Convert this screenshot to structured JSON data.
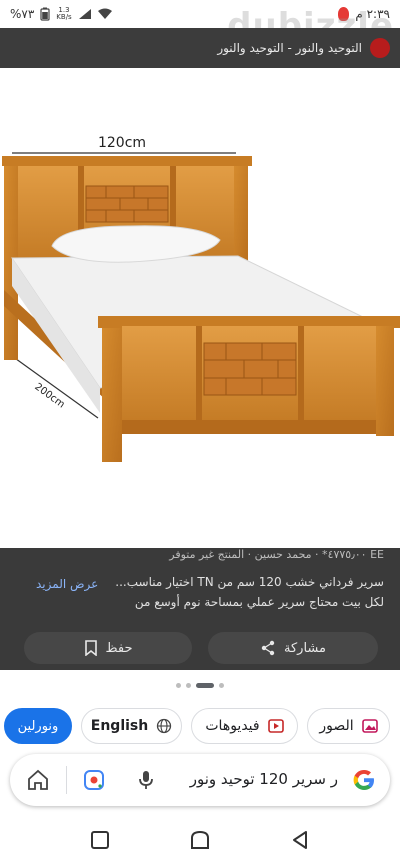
{
  "status_bar": {
    "time": "٢:٣٩ م",
    "battery": "%٧٣",
    "speed_value": "1.3",
    "speed_unit": "KB/s"
  },
  "watermark": "dubizzle",
  "title_bar": {
    "title": "التوحيد والنور - التوحيد والنور"
  },
  "image": {
    "width_label": "120cm",
    "length_label": "200cm"
  },
  "result": {
    "meta": "EE ٤٧٧٥٫٠٠* · محمد حسين · المنتج غير متوفر",
    "description": "سرير فرداني خشب 120 سم من TN اختيار مناسب... لكل بيت محتاج سرير عملي بمساحة نوم أوسع من",
    "see_more": "عرض المزيد",
    "share_label": "مشاركة",
    "save_label": "حفظ"
  },
  "chips": {
    "images": "الصور",
    "videos": "فيديوهات",
    "english": "English",
    "online": "ونورلين"
  },
  "search": {
    "query": "ر سرير 120 توحيد ونور"
  },
  "colors": {
    "accent": "#1a73e8",
    "dark_panel": "#3a3a3a",
    "title_bar": "#3c3c3c",
    "wood": "#c9822a"
  }
}
